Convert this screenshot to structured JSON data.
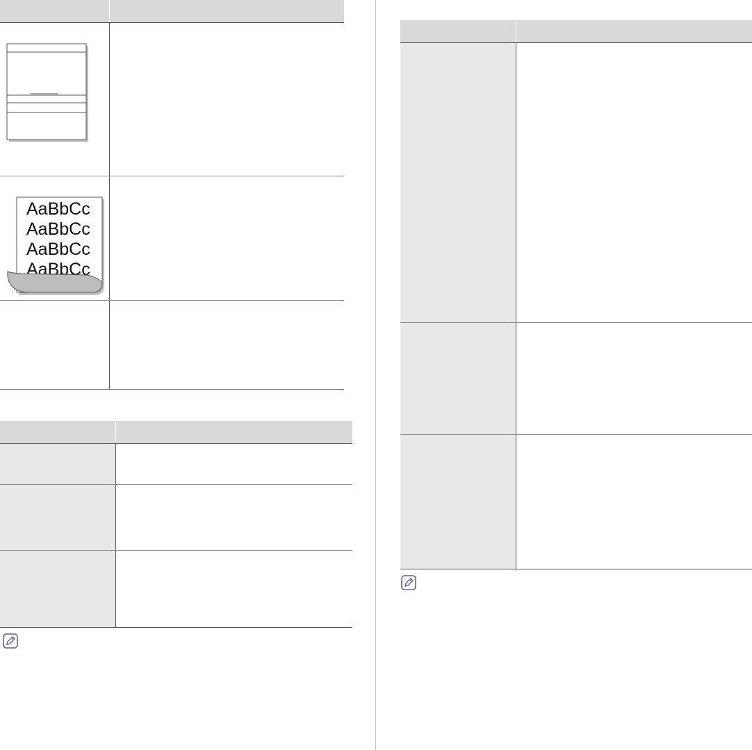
{
  "illustrations": {
    "curl_sample": {
      "lines": [
        "AaBbCc",
        "AaBbCc",
        "AaBbCc",
        "AaBbCc"
      ]
    }
  },
  "icons": {
    "note": "note-pencil-icon",
    "blank_page": "blank-page-icon",
    "curled_page": "curled-page-icon"
  },
  "colors": {
    "header_fill": "#d9d9d9",
    "first_column_fill": "#e8e8e8",
    "rules": "#555555",
    "icon_accent": "#6a5f8c"
  }
}
